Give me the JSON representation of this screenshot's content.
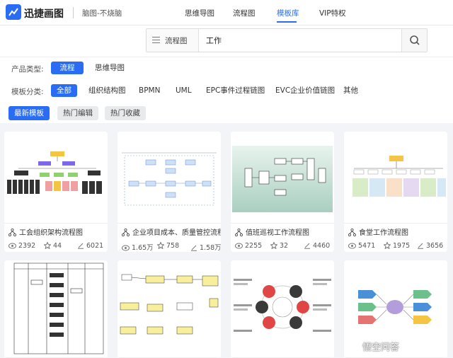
{
  "brand": {
    "name": "迅捷画图",
    "slogan": "脑图-不烧脑"
  },
  "nav": [
    {
      "label": "思维导图",
      "active": false
    },
    {
      "label": "流程图",
      "active": false
    },
    {
      "label": "模板库",
      "active": true
    },
    {
      "label": "VIP特权",
      "active": false
    }
  ],
  "search": {
    "type_label": "流程图",
    "query": "工作"
  },
  "filters": {
    "product_label": "产品类型:",
    "products": [
      {
        "label": "流程图",
        "selected": true
      },
      {
        "label": "思维导图",
        "selected": false
      }
    ],
    "category_label": "模板分类:",
    "categories": [
      {
        "label": "全部",
        "selected": true
      },
      {
        "label": "组织结构图",
        "selected": false
      },
      {
        "label": "BPMN",
        "selected": false
      },
      {
        "label": "UML",
        "selected": false
      },
      {
        "label": "EPC事件过程链图",
        "selected": false
      },
      {
        "label": "EVC企业价值链图",
        "selected": false
      },
      {
        "label": "其他",
        "selected": false
      }
    ],
    "sorts": [
      {
        "label": "最新模板",
        "selected": true
      },
      {
        "label": "热门编辑",
        "selected": false
      },
      {
        "label": "热门收藏",
        "selected": false
      }
    ]
  },
  "cards": [
    {
      "title": "工会组织架构流程图",
      "views": "2392",
      "likes": "44",
      "edits": "6021"
    },
    {
      "title": "企业项目成本、质量管控流程图",
      "views": "1.65万",
      "likes": "758",
      "edits": "1.58万"
    },
    {
      "title": "值班巡视工作流程图",
      "views": "2255",
      "likes": "32",
      "edits": "4460"
    },
    {
      "title": "食堂工作流程图",
      "views": "5471",
      "likes": "1975",
      "edits": "3656"
    }
  ],
  "watermark": "悟空问答",
  "colors": {
    "accent": "#2a6df4"
  }
}
